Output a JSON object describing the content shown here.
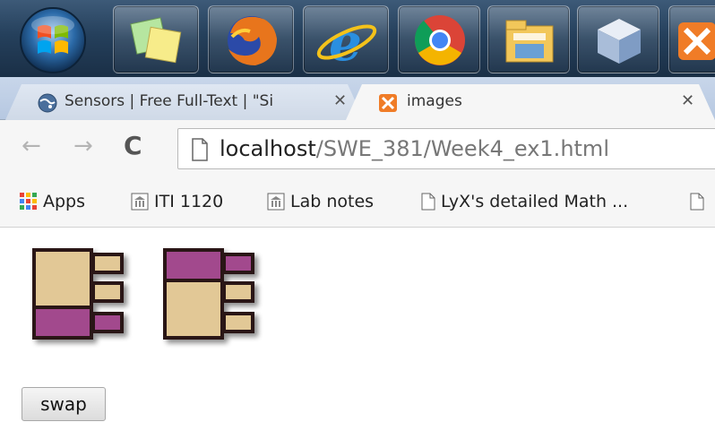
{
  "taskbar": {
    "buttons": [
      {
        "icon": "windows-start-icon"
      },
      {
        "icon": "sticky-notes-icon"
      },
      {
        "icon": "firefox-icon"
      },
      {
        "icon": "internet-explorer-icon"
      },
      {
        "icon": "chrome-icon"
      },
      {
        "icon": "file-explorer-icon"
      },
      {
        "icon": "cube-app-icon"
      },
      {
        "icon": "xampp-icon"
      }
    ]
  },
  "tabs": [
    {
      "title": "Sensors | Free Full-Text | \"Si",
      "icon": "globe-icon",
      "active": false
    },
    {
      "title": "images",
      "icon": "xampp-icon",
      "active": true
    }
  ],
  "addressbar": {
    "host": "localhost",
    "path": "/SWE_381/Week4_ex1.html",
    "icon": "page-icon"
  },
  "bookmarks": [
    {
      "label": "Apps",
      "icon": "apps-grid-icon"
    },
    {
      "label": "ITI 1120",
      "icon": "university-icon"
    },
    {
      "label": "Lab notes",
      "icon": "university-icon"
    },
    {
      "label": "LyX's detailed Math ...",
      "icon": "page-icon"
    }
  ],
  "page": {
    "swap_button": "swap"
  },
  "colors": {
    "tan": "#e2c896",
    "purple": "#a24a8d",
    "outline": "#2a1712",
    "taskbar": "#25405c",
    "tabstrip": "#c1d0e6"
  }
}
